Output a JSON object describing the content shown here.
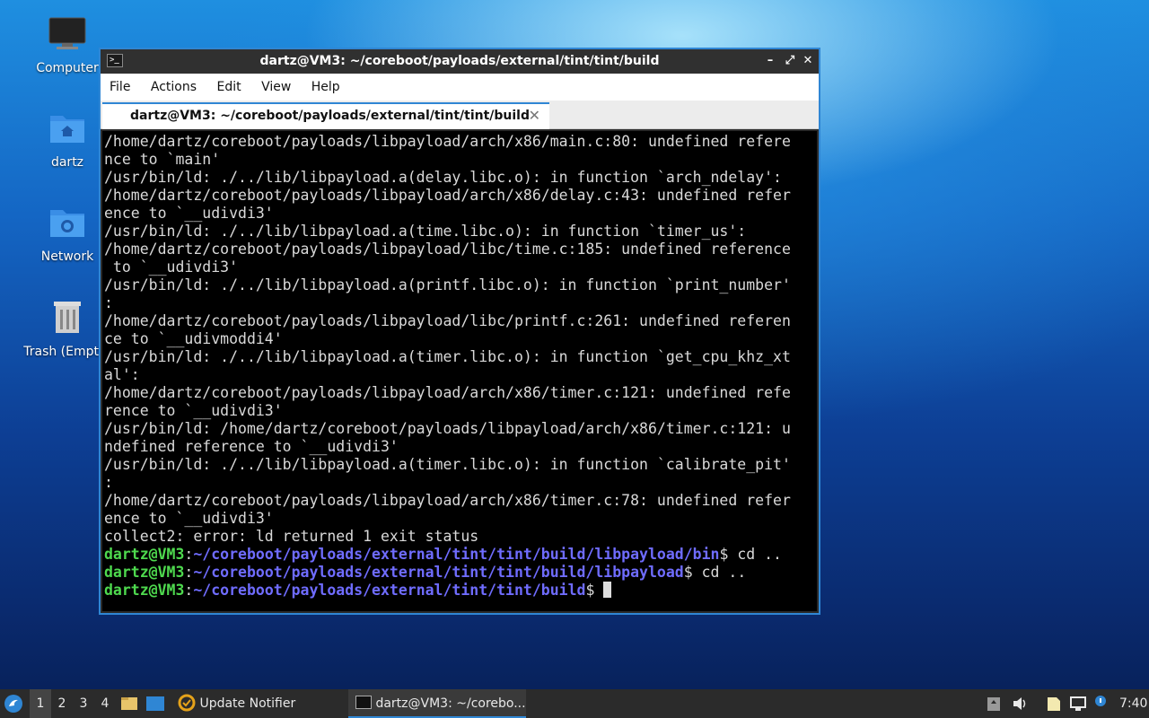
{
  "desktop": {
    "icons": [
      {
        "label": "Computer",
        "icon": "monitor-icon"
      },
      {
        "label": "dartz",
        "icon": "home-folder-icon"
      },
      {
        "label": "Network",
        "icon": "network-folder-icon"
      },
      {
        "label": "Trash (Empty)",
        "icon": "trash-icon"
      }
    ]
  },
  "window": {
    "title": "dartz@VM3: ~/coreboot/payloads/external/tint/tint/build",
    "buttons": {
      "minimize": "–",
      "maximize": "⤢",
      "close": "✕"
    },
    "menu": [
      "File",
      "Actions",
      "Edit",
      "View",
      "Help"
    ],
    "tab": {
      "label": "dartz@VM3: ~/coreboot/payloads/external/tint/tint/build",
      "close": "✕"
    }
  },
  "terminal": {
    "output": [
      "/home/dartz/coreboot/payloads/libpayload/arch/x86/main.c:80: undefined refere",
      "nce to `main'",
      "/usr/bin/ld: ./../lib/libpayload.a(delay.libc.o): in function `arch_ndelay':",
      "/home/dartz/coreboot/payloads/libpayload/arch/x86/delay.c:43: undefined refer",
      "ence to `__udivdi3'",
      "/usr/bin/ld: ./../lib/libpayload.a(time.libc.o): in function `timer_us':",
      "/home/dartz/coreboot/payloads/libpayload/libc/time.c:185: undefined reference",
      " to `__udivdi3'",
      "/usr/bin/ld: ./../lib/libpayload.a(printf.libc.o): in function `print_number'",
      ":",
      "/home/dartz/coreboot/payloads/libpayload/libc/printf.c:261: undefined referen",
      "ce to `__udivmoddi4'",
      "/usr/bin/ld: ./../lib/libpayload.a(timer.libc.o): in function `get_cpu_khz_xt",
      "al':",
      "/home/dartz/coreboot/payloads/libpayload/arch/x86/timer.c:121: undefined refe",
      "rence to `__udivdi3'",
      "/usr/bin/ld: /home/dartz/coreboot/payloads/libpayload/arch/x86/timer.c:121: u",
      "ndefined reference to `__udivdi3'",
      "/usr/bin/ld: ./../lib/libpayload.a(timer.libc.o): in function `calibrate_pit'",
      ":",
      "/home/dartz/coreboot/payloads/libpayload/arch/x86/timer.c:78: undefined refer",
      "ence to `__udivdi3'",
      "collect2: error: ld returned 1 exit status"
    ],
    "prompts": [
      {
        "user": "dartz@VM3",
        "sep": ":",
        "path": "~/coreboot/payloads/external/tint/tint/build/libpayload/bin",
        "cmd": "$ cd .."
      },
      {
        "user": "dartz@VM3",
        "sep": ":",
        "path": "~/coreboot/payloads/external/tint/tint/build/libpayload",
        "cmd": "$ cd .."
      },
      {
        "user": "dartz@VM3",
        "sep": ":",
        "path": "~/coreboot/payloads/external/tint/tint/build",
        "cmd": "$ "
      }
    ]
  },
  "taskbar": {
    "workspaces": [
      "1",
      "2",
      "3",
      "4"
    ],
    "active_workspace": "1",
    "tasks": [
      {
        "label": "Update Notifier",
        "icon": "update-notifier-icon"
      },
      {
        "label": "dartz@VM3: ~/corebo...",
        "icon": "terminal-icon"
      }
    ],
    "clock": "7:40"
  },
  "colors": {
    "accent": "#2f86d4",
    "prompt_user": "#4ed94e",
    "prompt_path": "#6f6cff"
  }
}
